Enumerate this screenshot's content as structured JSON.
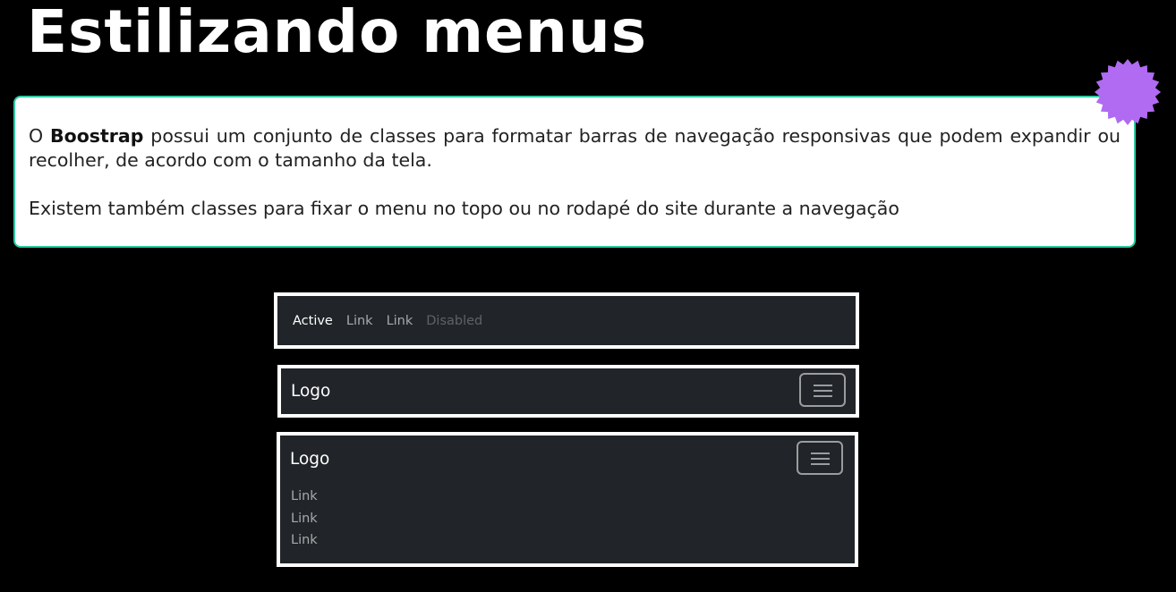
{
  "slide": {
    "title": "Estilizando menus"
  },
  "info": {
    "p1_before": "O ",
    "p1_bold": "Boostrap",
    "p1_after": " possui um conjunto de classes para formatar barras de navegação responsivas que podem expandir ou recolher, de acordo com o tamanho da tela.",
    "p2": "Existem também classes para fixar o menu no topo ou no rodapé do site durante a navegação"
  },
  "badge": {
    "icon": "starburst-badge-icon",
    "color": "#b06bf2"
  },
  "navbar1": {
    "links": [
      "Active",
      "Link",
      "Link",
      "Disabled"
    ]
  },
  "navbar2": {
    "brand": "Logo",
    "toggler_icon": "hamburger-icon"
  },
  "navbar3": {
    "brand": "Logo",
    "toggler_icon": "hamburger-icon",
    "links": [
      "Link",
      "Link",
      "Link"
    ]
  },
  "colors": {
    "background": "#000000",
    "navbar_bg": "#212529",
    "box_border": "#2ec9a0"
  }
}
